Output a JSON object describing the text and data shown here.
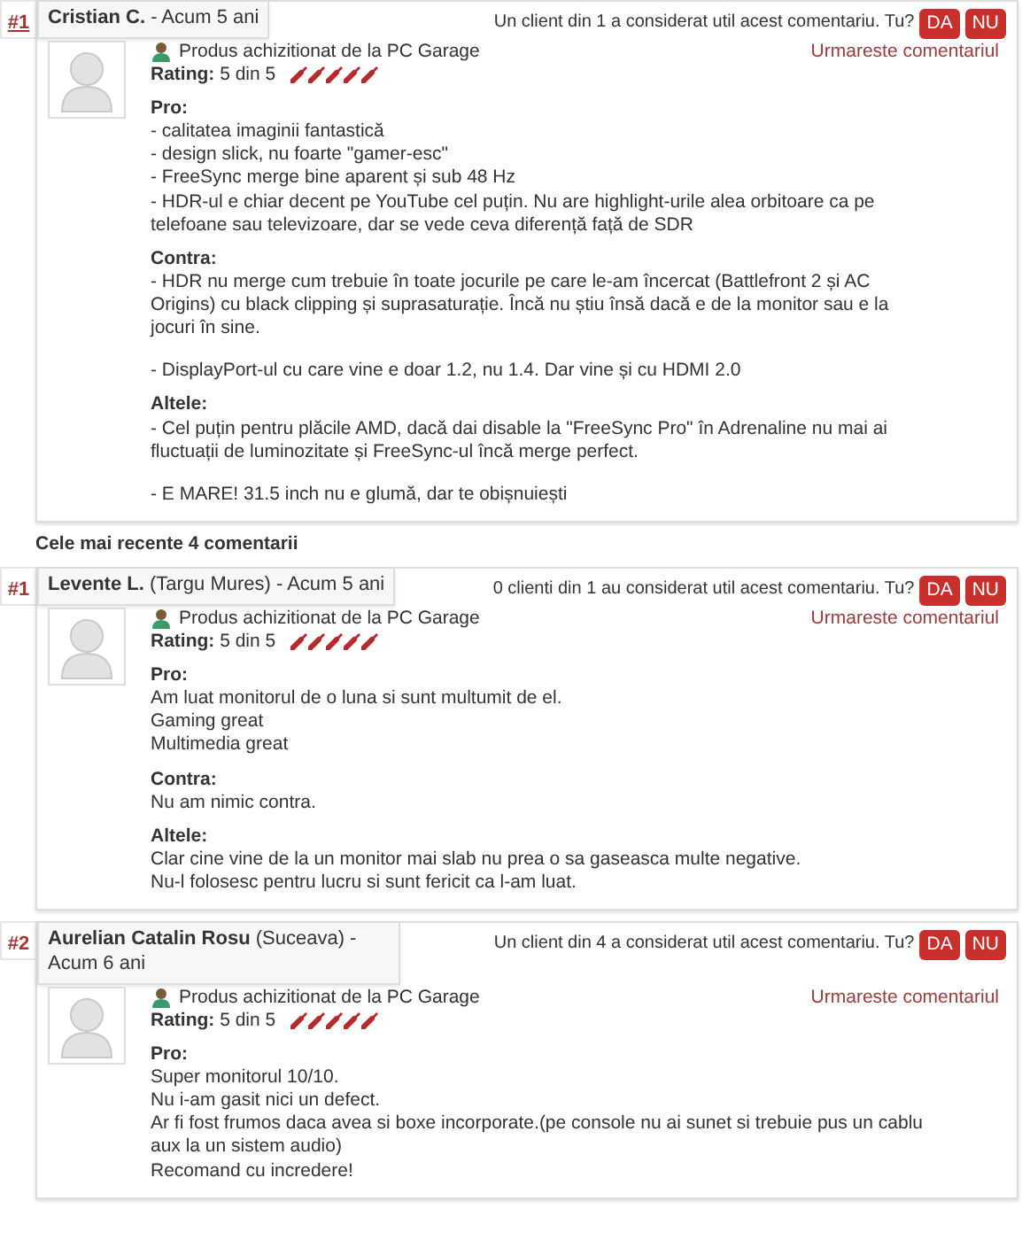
{
  "reviews": [
    {
      "index": "#1",
      "index_link": true,
      "name": "Cristian C.",
      "age": " - Acum 5 ani",
      "helpful": "Un client din 1 a considerat util acest comentariu. Tu?",
      "yes": "DA",
      "no": "NU",
      "follow": "Urmareste comentariul",
      "purchased": "Produs achizitionat de la PC Garage",
      "rating_label": "Rating:",
      "rating_text": "5 din 5",
      "stars": 5,
      "sections": [
        {
          "title": "Pro:",
          "paragraphs": [
            [
              "- calitatea imaginii fantastică",
              "- design slick, nu foarte \"gamer-esc\"",
              "- FreeSync merge bine aparent și sub 48 Hz",
              "- HDR-ul e chiar decent pe YouTube cel puțin. Nu are highlight-urile alea orbitoare ca pe telefoane sau televizoare, dar se vede ceva diferență față de SDR"
            ]
          ]
        },
        {
          "title": "Contra:",
          "paragraphs": [
            [
              "- HDR nu merge cum trebuie în toate jocurile pe care le-am încercat (Battlefront 2 și AC Origins) cu black clipping și suprasaturație. Încă nu știu însă dacă e de la monitor sau e la jocuri în sine."
            ],
            [
              "- DisplayPort-ul cu care vine e doar 1.2, nu 1.4. Dar vine și cu HDMI 2.0"
            ]
          ]
        },
        {
          "title": "Altele:",
          "paragraphs": [
            [
              "- Cel puțin pentru plăcile AMD, dacă dai disable la \"FreeSync Pro\" în Adrenaline nu mai ai fluctuații de luminozitate și FreeSync-ul încă merge perfect."
            ],
            [
              "- E MARE! 31.5 inch nu e glumă, dar te obișnuiești"
            ]
          ]
        }
      ]
    },
    {
      "heading": "Cele mai recente 4 comentarii"
    },
    {
      "index": "#1",
      "index_link": false,
      "name": "Levente L.",
      "location": " (Targu Mures)",
      "age": " - Acum 5 ani",
      "helpful": "0 clienti din 1 au considerat util acest comentariu. Tu?",
      "yes": "DA",
      "no": "NU",
      "follow": "Urmareste comentariul",
      "purchased": "Produs achizitionat de la PC Garage",
      "rating_label": "Rating:",
      "rating_text": "5 din 5",
      "stars": 5,
      "sections": [
        {
          "title": "Pro:",
          "paragraphs": [
            [
              "Am luat monitorul de o luna si sunt multumit de el.",
              "Gaming great",
              "Multimedia great"
            ]
          ]
        },
        {
          "title": "Contra:",
          "paragraphs": [
            [
              "Nu am nimic contra."
            ]
          ]
        },
        {
          "title": "Altele:",
          "paragraphs": [
            [
              "Clar cine vine de la un monitor mai slab nu prea o sa gaseasca multe negative.",
              "Nu-l folosesc pentru lucru si sunt fericit ca l-am luat."
            ]
          ]
        }
      ]
    },
    {
      "index": "#2",
      "index_link": false,
      "name": "Aurelian Catalin Rosu",
      "location": " (Suceava)",
      "age": " - Acum 6 ani",
      "helpful": "Un client din 4 a considerat util acest comentariu. Tu?",
      "yes": "DA",
      "no": "NU",
      "follow": "Urmareste comentariul",
      "purchased": "Produs achizitionat de la PC Garage",
      "rating_label": "Rating:",
      "rating_text": "5 din 5",
      "stars": 5,
      "sections": [
        {
          "title": "Pro:",
          "paragraphs": [
            [
              "Super monitorul 10/10.",
              "Nu i-am gasit nici un defect.",
              "Ar fi fost frumos daca avea si boxe incorporate.(pe console nu ai sunet si trebuie pus un cablu aux la un sistem audio)",
              "Recomand cu incredere!"
            ]
          ]
        }
      ]
    }
  ]
}
